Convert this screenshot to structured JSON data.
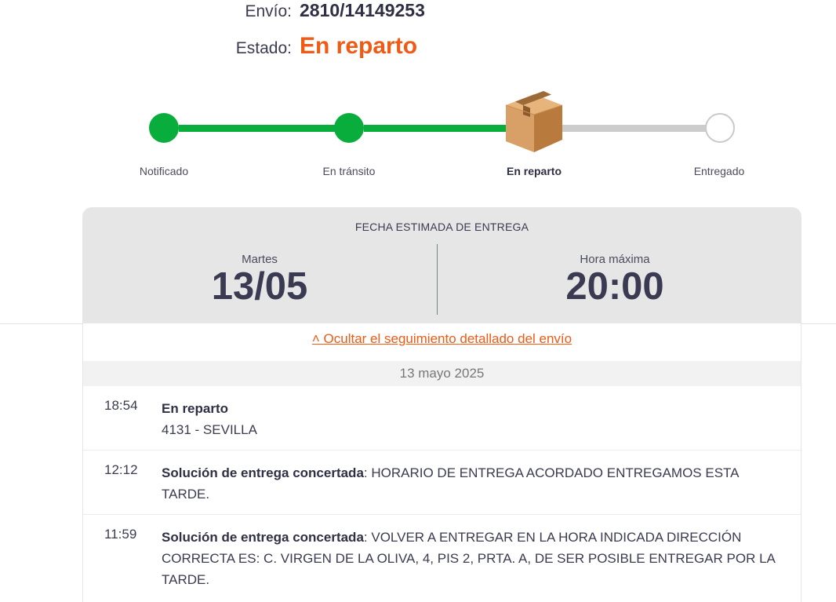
{
  "shipment": {
    "envio_label": "Envío:",
    "envio_value": "2810/14149253",
    "estado_label": "Estado:",
    "estado_value": "En reparto",
    "accent_color": "#ef5a14"
  },
  "progress": {
    "steps": [
      {
        "label": "Notificado",
        "status": "done"
      },
      {
        "label": "En tránsito",
        "status": "done"
      },
      {
        "label": "En reparto",
        "status": "current",
        "icon": "package-box-icon"
      },
      {
        "label": "Entregado",
        "status": "pending"
      }
    ],
    "done_color": "#09ad3c",
    "pending_color": "#cccccc"
  },
  "estimate": {
    "title": "FECHA ESTIMADA DE ENTREGA",
    "day_label": "Martes",
    "date": "13/05",
    "time_label": "Hora máxima",
    "time": "20:00"
  },
  "tracking": {
    "toggle_label": "˄ Ocultar el seguimiento detallado del envío",
    "date_header": "13 mayo 2025",
    "events": [
      {
        "time": "18:54",
        "title": "En reparto",
        "text": "",
        "line2": "4131 - SEVILLA"
      },
      {
        "time": "12:12",
        "title": "Solución de entrega concertada",
        "text": ": HORARIO DE ENTREGA ACORDADO ENTREGAMOS ESTA TARDE.",
        "line2": ""
      },
      {
        "time": "11:59",
        "title": "Solución de entrega concertada",
        "text": ": VOLVER A ENTREGAR EN LA HORA INDICADA DIRECCIÓN CORRECTA ES: C. VIRGEN DE LA OLIVA, 4, PIS 2, PRTA. A, DE SER POSIBLE ENTREGAR POR LA TARDE.",
        "line2": ""
      }
    ]
  }
}
